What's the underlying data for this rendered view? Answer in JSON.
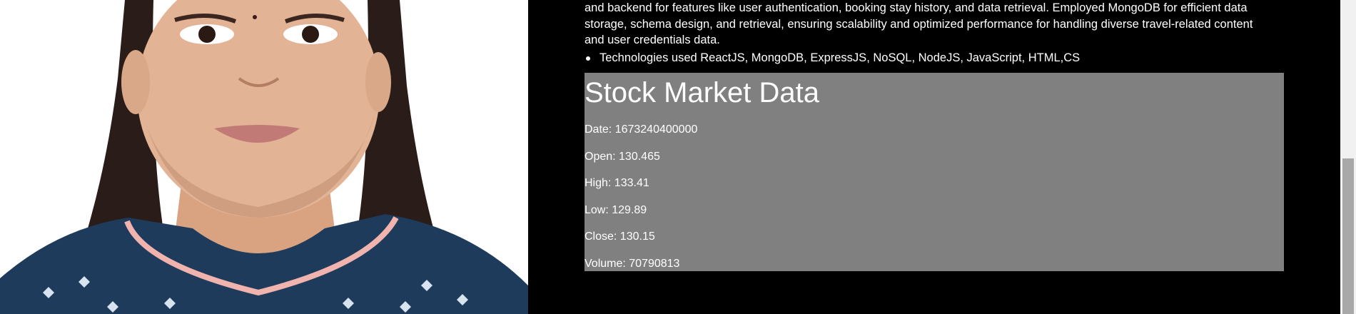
{
  "photo": {
    "alt": "profile photo"
  },
  "project": {
    "description_lines": [
      "and backend for features like user authentication, booking stay history, and data retrieval. Employed MongoDB for efficient data",
      "storage, schema design, and retrieval, ensuring scalability and optimized performance for handling diverse travel-related content",
      "and user credentials data."
    ],
    "bullets": [
      "Technologies used ReactJS, MongoDB, ExpressJS, NoSQL, NodeJS, JavaScript, HTML,CS"
    ]
  },
  "stock": {
    "title": "Stock Market Data",
    "rows": [
      "Date: 1673240400000",
      "Open: 130.465",
      "High: 133.41",
      "Low: 129.89",
      "Close: 130.15",
      "Volume: 70790813"
    ]
  },
  "colors": {
    "background": "#000000",
    "stock_panel": "#808080",
    "text": "#ffffff"
  }
}
